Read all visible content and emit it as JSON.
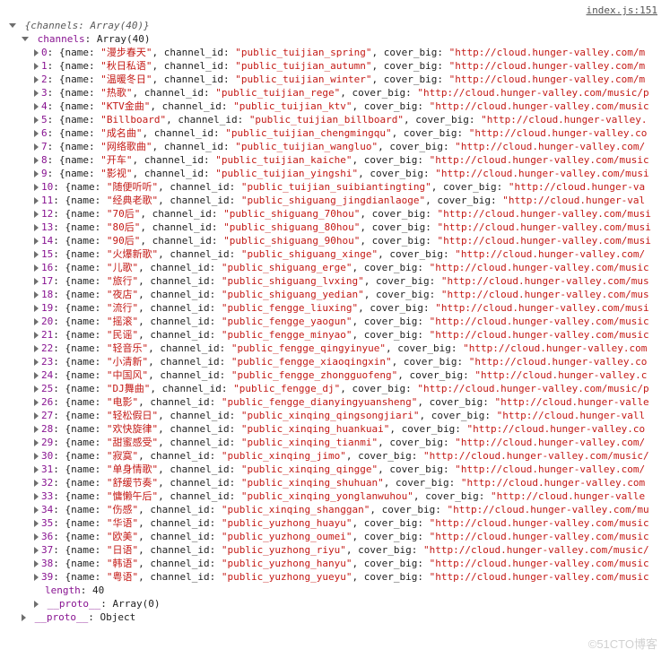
{
  "source": {
    "file": "index.js",
    "line": "151"
  },
  "root": {
    "summary_prefix": "{channels: ",
    "summary_array": "Array(40)",
    "summary_suffix": "}",
    "channels_label": "channels",
    "channels_type": "Array(40)",
    "length_label": "length",
    "length_value": "40",
    "proto_label": "__proto__",
    "proto_array": "Array(0)",
    "proto_object": "Object"
  },
  "labels": {
    "name": "name",
    "channel_id": "channel_id",
    "cover_big": "cover_big"
  },
  "channels": [
    {
      "idx": "0",
      "name": "\"漫步春天\"",
      "cid": "\"public_tuijian_spring\"",
      "cov": "\"http://cloud.hunger-valley.com/m"
    },
    {
      "idx": "1",
      "name": "\"秋日私语\"",
      "cid": "\"public_tuijian_autumn\"",
      "cov": "\"http://cloud.hunger-valley.com/m"
    },
    {
      "idx": "2",
      "name": "\"温暖冬日\"",
      "cid": "\"public_tuijian_winter\"",
      "cov": "\"http://cloud.hunger-valley.com/m"
    },
    {
      "idx": "3",
      "name": "\"热歌\"",
      "cid": "\"public_tuijian_rege\"",
      "cov": "\"http://cloud.hunger-valley.com/music/p"
    },
    {
      "idx": "4",
      "name": "\"KTV金曲\"",
      "cid": "\"public_tuijian_ktv\"",
      "cov": "\"http://cloud.hunger-valley.com/music"
    },
    {
      "idx": "5",
      "name": "\"Billboard\"",
      "cid": "\"public_tuijian_billboard\"",
      "cov": "\"http://cloud.hunger-valley."
    },
    {
      "idx": "6",
      "name": "\"成名曲\"",
      "cid": "\"public_tuijian_chengmingqu\"",
      "cov": "\"http://cloud.hunger-valley.co"
    },
    {
      "idx": "7",
      "name": "\"网络歌曲\"",
      "cid": "\"public_tuijian_wangluo\"",
      "cov": "\"http://cloud.hunger-valley.com/"
    },
    {
      "idx": "8",
      "name": "\"开车\"",
      "cid": "\"public_tuijian_kaiche\"",
      "cov": "\"http://cloud.hunger-valley.com/music"
    },
    {
      "idx": "9",
      "name": "\"影视\"",
      "cid": "\"public_tuijian_yingshi\"",
      "cov": "\"http://cloud.hunger-valley.com/musi"
    },
    {
      "idx": "10",
      "name": "\"随便听听\"",
      "cid": "\"public_tuijian_suibiantingting\"",
      "cov": "\"http://cloud.hunger-va"
    },
    {
      "idx": "11",
      "name": "\"经典老歌\"",
      "cid": "\"public_shiguang_jingdianlaoge\"",
      "cov": "\"http://cloud.hunger-val"
    },
    {
      "idx": "12",
      "name": "\"70后\"",
      "cid": "\"public_shiguang_70hou\"",
      "cov": "\"http://cloud.hunger-valley.com/musi"
    },
    {
      "idx": "13",
      "name": "\"80后\"",
      "cid": "\"public_shiguang_80hou\"",
      "cov": "\"http://cloud.hunger-valley.com/musi"
    },
    {
      "idx": "14",
      "name": "\"90后\"",
      "cid": "\"public_shiguang_90hou\"",
      "cov": "\"http://cloud.hunger-valley.com/musi"
    },
    {
      "idx": "15",
      "name": "\"火爆新歌\"",
      "cid": "\"public_shiguang_xinge\"",
      "cov": "\"http://cloud.hunger-valley.com/"
    },
    {
      "idx": "16",
      "name": "\"儿歌\"",
      "cid": "\"public_shiguang_erge\"",
      "cov": "\"http://cloud.hunger-valley.com/music"
    },
    {
      "idx": "17",
      "name": "\"旅行\"",
      "cid": "\"public_shiguang_lvxing\"",
      "cov": "\"http://cloud.hunger-valley.com/mus"
    },
    {
      "idx": "18",
      "name": "\"夜店\"",
      "cid": "\"public_shiguang_yedian\"",
      "cov": "\"http://cloud.hunger-valley.com/mus"
    },
    {
      "idx": "19",
      "name": "\"流行\"",
      "cid": "\"public_fengge_liuxing\"",
      "cov": "\"http://cloud.hunger-valley.com/musi"
    },
    {
      "idx": "20",
      "name": "\"摇滚\"",
      "cid": "\"public_fengge_yaogun\"",
      "cov": "\"http://cloud.hunger-valley.com/music"
    },
    {
      "idx": "21",
      "name": "\"民谣\"",
      "cid": "\"public_fengge_minyao\"",
      "cov": "\"http://cloud.hunger-valley.com/music"
    },
    {
      "idx": "22",
      "name": "\"轻音乐\"",
      "cid": "\"public_fengge_qingyinyue\"",
      "cov": "\"http://cloud.hunger-valley.com"
    },
    {
      "idx": "23",
      "name": "\"小清新\"",
      "cid": "\"public_fengge_xiaoqingxin\"",
      "cov": "\"http://cloud.hunger-valley.co"
    },
    {
      "idx": "24",
      "name": "\"中国风\"",
      "cid": "\"public_fengge_zhongguofeng\"",
      "cov": "\"http://cloud.hunger-valley.c"
    },
    {
      "idx": "25",
      "name": "\"DJ舞曲\"",
      "cid": "\"public_fengge_dj\"",
      "cov": "\"http://cloud.hunger-valley.com/music/p"
    },
    {
      "idx": "26",
      "name": "\"电影\"",
      "cid": "\"public_fengge_dianyingyuansheng\"",
      "cov": "\"http://cloud.hunger-valle"
    },
    {
      "idx": "27",
      "name": "\"轻松假日\"",
      "cid": "\"public_xinqing_qingsongjiari\"",
      "cov": "\"http://cloud.hunger-vall"
    },
    {
      "idx": "28",
      "name": "\"欢快旋律\"",
      "cid": "\"public_xinqing_huankuai\"",
      "cov": "\"http://cloud.hunger-valley.co"
    },
    {
      "idx": "29",
      "name": "\"甜蜜感受\"",
      "cid": "\"public_xinqing_tianmi\"",
      "cov": "\"http://cloud.hunger-valley.com/"
    },
    {
      "idx": "30",
      "name": "\"寂寞\"",
      "cid": "\"public_xinqing_jimo\"",
      "cov": "\"http://cloud.hunger-valley.com/music/"
    },
    {
      "idx": "31",
      "name": "\"单身情歌\"",
      "cid": "\"public_xinqing_qingge\"",
      "cov": "\"http://cloud.hunger-valley.com/"
    },
    {
      "idx": "32",
      "name": "\"舒缓节奏\"",
      "cid": "\"public_xinqing_shuhuan\"",
      "cov": "\"http://cloud.hunger-valley.com"
    },
    {
      "idx": "33",
      "name": "\"慵懒午后\"",
      "cid": "\"public_xinqing_yonglanwuhou\"",
      "cov": "\"http://cloud.hunger-valle"
    },
    {
      "idx": "34",
      "name": "\"伤感\"",
      "cid": "\"public_xinqing_shanggan\"",
      "cov": "\"http://cloud.hunger-valley.com/mu"
    },
    {
      "idx": "35",
      "name": "\"华语\"",
      "cid": "\"public_yuzhong_huayu\"",
      "cov": "\"http://cloud.hunger-valley.com/music"
    },
    {
      "idx": "36",
      "name": "\"欧美\"",
      "cid": "\"public_yuzhong_oumei\"",
      "cov": "\"http://cloud.hunger-valley.com/music"
    },
    {
      "idx": "37",
      "name": "\"日语\"",
      "cid": "\"public_yuzhong_riyu\"",
      "cov": "\"http://cloud.hunger-valley.com/music/"
    },
    {
      "idx": "38",
      "name": "\"韩语\"",
      "cid": "\"public_yuzhong_hanyu\"",
      "cov": "\"http://cloud.hunger-valley.com/music"
    },
    {
      "idx": "39",
      "name": "\"粤语\"",
      "cid": "\"public_yuzhong_yueyu\"",
      "cov": "\"http://cloud.hunger-valley.com/music"
    }
  ],
  "watermark": "©51CTO博客"
}
